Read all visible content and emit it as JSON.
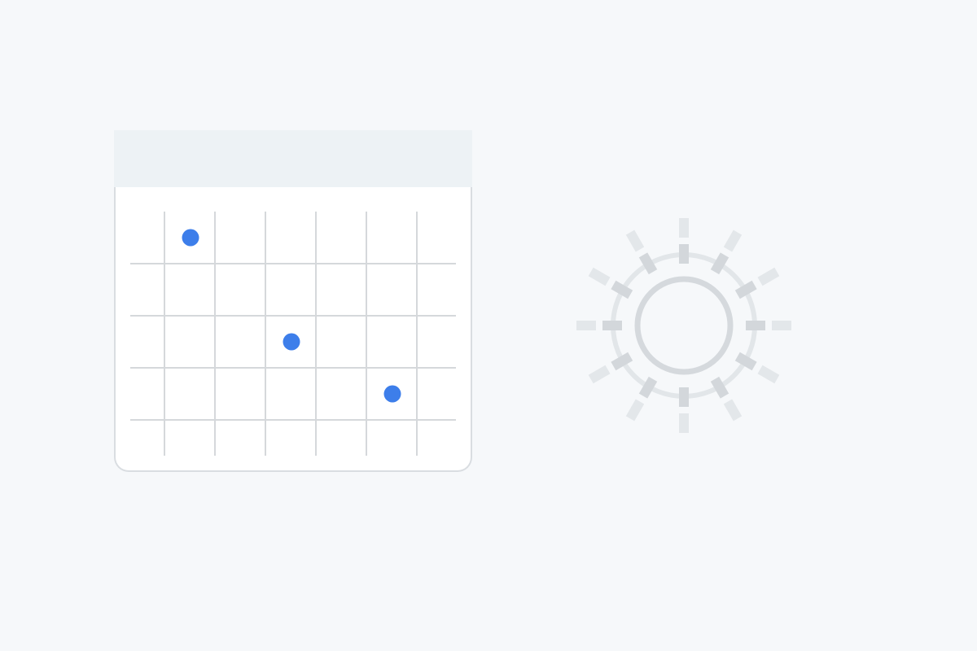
{
  "colors": {
    "background": "#f6f8fa",
    "calendar_header": "#edf2f5",
    "calendar_body": "#ffffff",
    "calendar_border": "#d9dde1",
    "grid_line": "#d5d8db",
    "event_dot": "#3d7eea",
    "gear_stroke": "#d5d9dd",
    "gear_outer_ring": "#e2e6e9",
    "gear_ticks_inner": "#d3d7db",
    "gear_ticks_outer": "#e3e7ea"
  },
  "icons": {
    "calendar": "calendar-icon",
    "settings": "gear-icon"
  },
  "calendar": {
    "rows": 5,
    "columns": 7,
    "event_dots": [
      {
        "row": 0,
        "col": 1
      },
      {
        "row": 2,
        "col": 3
      },
      {
        "row": 3,
        "col": 5
      }
    ]
  }
}
